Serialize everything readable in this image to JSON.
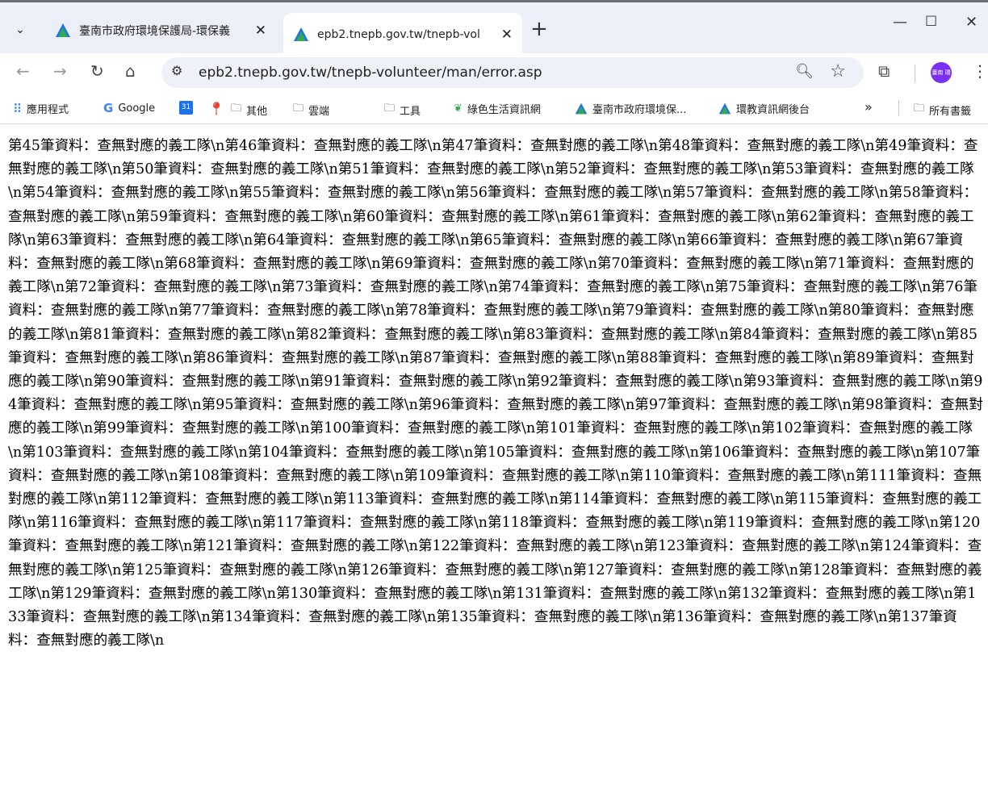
{
  "tabs": [
    {
      "title": "臺南市政府環境保護局-環保義",
      "active": false
    },
    {
      "title": "epb2.tnepb.gov.tw/tnepb-vol",
      "active": true
    }
  ],
  "toolbar": {
    "url": "epb2.tnepb.gov.tw/tnepb-volunteer/man/error.asp",
    "avatar_text": "臺南 環保局"
  },
  "bookmarks": [
    {
      "label": "應用程式",
      "icon": "apps-grid-icon"
    },
    {
      "label": "Google",
      "icon": "google-icon"
    },
    {
      "label": "",
      "icon": "calendar-icon"
    },
    {
      "label": "",
      "icon": "maps-pin-icon"
    },
    {
      "label": "其他",
      "icon": "folder-icon"
    },
    {
      "label": "雲端",
      "icon": "folder-icon"
    },
    {
      "label": "工具",
      "icon": "folder-icon"
    },
    {
      "label": "綠色生活資訊網",
      "icon": "leaf-icon"
    },
    {
      "label": "臺南市政府環境保...",
      "icon": "tnepb-logo-icon"
    },
    {
      "label": "環教資訊網後台",
      "icon": "tnepb-logo-icon"
    },
    {
      "label": "所有書籤",
      "icon": "folder-icon"
    }
  ],
  "content": {
    "message": "第45筆資料：查無對應的義工隊\\n第46筆資料：查無對應的義工隊\\n第47筆資料：查無對應的義工隊\\n第48筆資料：查無對應的義工隊\\n第49筆資料：查無對應的義工隊\\n第50筆資料：查無對應的義工隊\\n第51筆資料：查無對應的義工隊\\n第52筆資料：查無對應的義工隊\\n第53筆資料：查無對應的義工隊\\n第54筆資料：查無對應的義工隊\\n第55筆資料：查無對應的義工隊\\n第56筆資料：查無對應的義工隊\\n第57筆資料：查無對應的義工隊\\n第58筆資料：查無對應的義工隊\\n第59筆資料：查無對應的義工隊\\n第60筆資料：查無對應的義工隊\\n第61筆資料：查無對應的義工隊\\n第62筆資料：查無對應的義工隊\\n第63筆資料：查無對應的義工隊\\n第64筆資料：查無對應的義工隊\\n第65筆資料：查無對應的義工隊\\n第66筆資料：查無對應的義工隊\\n第67筆資料：查無對應的義工隊\\n第68筆資料：查無對應的義工隊\\n第69筆資料：查無對應的義工隊\\n第70筆資料：查無對應的義工隊\\n第71筆資料：查無對應的義工隊\\n第72筆資料：查無對應的義工隊\\n第73筆資料：查無對應的義工隊\\n第74筆資料：查無對應的義工隊\\n第75筆資料：查無對應的義工隊\\n第76筆資料：查無對應的義工隊\\n第77筆資料：查無對應的義工隊\\n第78筆資料：查無對應的義工隊\\n第79筆資料：查無對應的義工隊\\n第80筆資料：查無對應的義工隊\\n第81筆資料：查無對應的義工隊\\n第82筆資料：查無對應的義工隊\\n第83筆資料：查無對應的義工隊\\n第84筆資料：查無對應的義工隊\\n第85筆資料：查無對應的義工隊\\n第86筆資料：查無對應的義工隊\\n第87筆資料：查無對應的義工隊\\n第88筆資料：查無對應的義工隊\\n第89筆資料：查無對應的義工隊\\n第90筆資料：查無對應的義工隊\\n第91筆資料：查無對應的義工隊\\n第92筆資料：查無對應的義工隊\\n第93筆資料：查無對應的義工隊\\n第94筆資料：查無對應的義工隊\\n第95筆資料：查無對應的義工隊\\n第96筆資料：查無對應的義工隊\\n第97筆資料：查無對應的義工隊\\n第98筆資料：查無對應的義工隊\\n第99筆資料：查無對應的義工隊\\n第100筆資料：查無對應的義工隊\\n第101筆資料：查無對應的義工隊\\n第102筆資料：查無對應的義工隊\\n第103筆資料：查無對應的義工隊\\n第104筆資料：查無對應的義工隊\\n第105筆資料：查無對應的義工隊\\n第106筆資料：查無對應的義工隊\\n第107筆資料：查無對應的義工隊\\n第108筆資料：查無對應的義工隊\\n第109筆資料：查無對應的義工隊\\n第110筆資料：查無對應的義工隊\\n第111筆資料：查無對應的義工隊\\n第112筆資料：查無對應的義工隊\\n第113筆資料：查無對應的義工隊\\n第114筆資料：查無對應的義工隊\\n第115筆資料：查無對應的義工隊\\n第116筆資料：查無對應的義工隊\\n第117筆資料：查無對應的義工隊\\n第118筆資料：查無對應的義工隊\\n第119筆資料：查無對應的義工隊\\n第120筆資料：查無對應的義工隊\\n第121筆資料：查無對應的義工隊\\n第122筆資料：查無對應的義工隊\\n第123筆資料：查無對應的義工隊\\n第124筆資料：查無對應的義工隊\\n第125筆資料：查無對應的義工隊\\n第126筆資料：查無對應的義工隊\\n第127筆資料：查無對應的義工隊\\n第128筆資料：查無對應的義工隊\\n第129筆資料：查無對應的義工隊\\n第130筆資料：查無對應的義工隊\\n第131筆資料：查無對應的義工隊\\n第132筆資料：查無對應的義工隊\\n第133筆資料：查無對應的義工隊\\n第134筆資料：查無對應的義工隊\\n第135筆資料：查無對應的義工隊\\n第136筆資料：查無對應的義工隊\\n第137筆資料：查無對應的義工隊\\n"
  }
}
